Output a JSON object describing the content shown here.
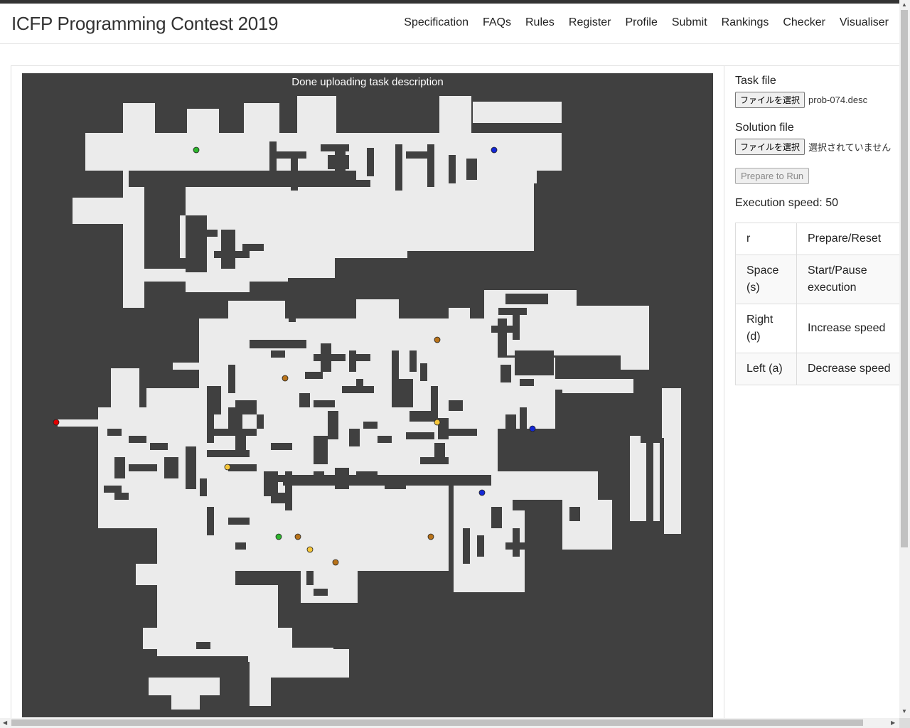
{
  "header": {
    "title": "ICFP Programming Contest 2019",
    "nav": [
      "Specification",
      "FAQs",
      "Rules",
      "Register",
      "Profile",
      "Submit",
      "Rankings",
      "Checker",
      "Visualiser"
    ]
  },
  "canvas": {
    "status": "Done uploading task description",
    "colors": {
      "wall": "#404040",
      "floor": "#ebebeb"
    }
  },
  "sidebar": {
    "task_label": "Task file",
    "task_button": "ファイルを選択",
    "task_filename": "prob-074.desc",
    "solution_label": "Solution file",
    "solution_button": "ファイルを選択",
    "solution_filename": "選択されていません",
    "run_button": "Prepare to Run",
    "speed_text": "Execution speed: 50",
    "keys": [
      {
        "key": "r",
        "action": "Prepare/Reset"
      },
      {
        "key": "Space (s)",
        "action": "Start/Pause execution"
      },
      {
        "key": "Right (d)",
        "action": "Increase speed"
      },
      {
        "key": "Left (a)",
        "action": "Decrease speed"
      }
    ]
  },
  "markers": [
    {
      "type": "worker",
      "color": "#e00000"
    },
    {
      "type": "boost-B",
      "color": "#2db52d"
    },
    {
      "type": "boost-B",
      "color": "#2db52d"
    },
    {
      "type": "boost-C",
      "color": "#1428d6"
    },
    {
      "type": "boost-C",
      "color": "#1428d6"
    },
    {
      "type": "boost-C",
      "color": "#1428d6"
    },
    {
      "type": "boost-L",
      "color": "#b8731a"
    },
    {
      "type": "boost-L",
      "color": "#b8731a"
    },
    {
      "type": "boost-L",
      "color": "#b8731a"
    },
    {
      "type": "boost-L",
      "color": "#b8731a"
    },
    {
      "type": "boost-L",
      "color": "#b8731a"
    },
    {
      "type": "boost-F",
      "color": "#f5c53a"
    },
    {
      "type": "boost-F",
      "color": "#f5c53a"
    },
    {
      "type": "boost-F",
      "color": "#f5c53a"
    }
  ]
}
